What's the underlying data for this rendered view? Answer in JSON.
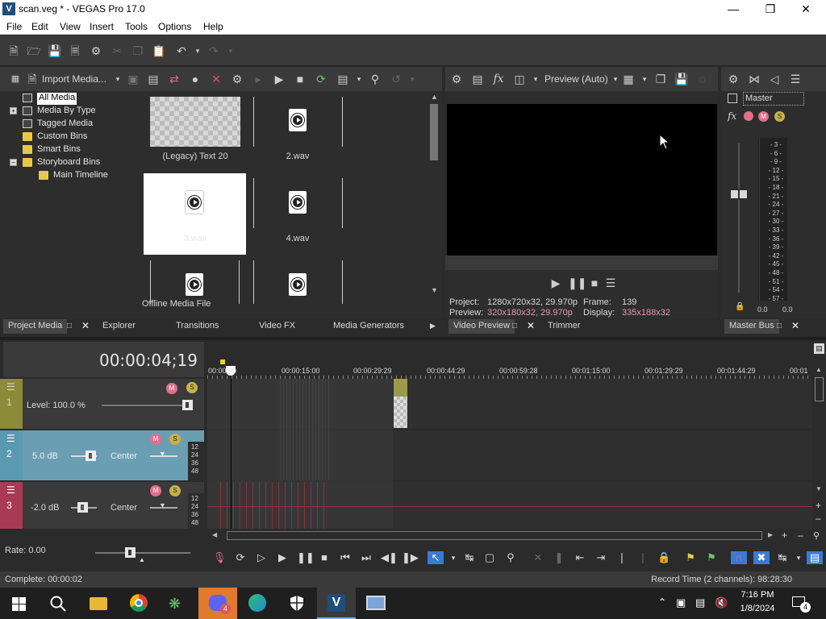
{
  "window": {
    "title": "scan.veg * - VEGAS Pro 17.0",
    "app_icon_letter": "V"
  },
  "menu": [
    "File",
    "Edit",
    "View",
    "Insert",
    "Tools",
    "Options",
    "Help"
  ],
  "project_media": {
    "import_label": "Import Media...",
    "tree": [
      {
        "label": "All Media",
        "selected": true
      },
      {
        "label": "Media By Type"
      },
      {
        "label": "Tagged Media"
      },
      {
        "label": "Custom Bins"
      },
      {
        "label": "Smart Bins"
      },
      {
        "label": "Storyboard Bins"
      },
      {
        "label": "Main Timeline"
      }
    ],
    "items": [
      {
        "label": "(Legacy) Text 20"
      },
      {
        "label": "2.wav"
      },
      {
        "label": "3.wav"
      },
      {
        "label": "4.wav"
      }
    ],
    "status": "Offline Media File"
  },
  "tabs_left": [
    "Project Media",
    "Explorer",
    "Transitions",
    "Video FX",
    "Media Generators"
  ],
  "preview": {
    "mode_label": "Preview (Auto)",
    "project_label": "Project:",
    "project_value": "1280x720x32, 29.970p",
    "frame_label": "Frame:",
    "frame_value": "139",
    "preview_label": "Preview:",
    "preview_value": "320x180x32, 29.970p",
    "display_label": "Display:",
    "display_value": "335x188x32",
    "tab_label": "Video Preview",
    "trimmer_label": "Trimmer"
  },
  "mixer": {
    "master_label": "Master",
    "scale": [
      "3",
      "6",
      "9",
      "12",
      "15",
      "18",
      "21",
      "24",
      "27",
      "30",
      "33",
      "36",
      "39",
      "42",
      "45",
      "48",
      "51",
      "54",
      "57"
    ],
    "left_reading": "0.0",
    "right_reading": "0.0",
    "tab_label": "Master Bus"
  },
  "timeline": {
    "timecode": "00:00:04;19",
    "ruler": [
      "00:00:00",
      "00:00:15:00",
      "00:00:29:29",
      "00:00:44:29",
      "00:00:59:28",
      "00:01:15:00",
      "00:01:29:29",
      "00:01:44:29",
      "00:01"
    ],
    "tracks": [
      {
        "num": "1",
        "label": "Level: 100.0 %",
        "color": "#8b8b3a"
      },
      {
        "num": "2",
        "vol": "5.0 dB",
        "pan": "Center",
        "color": "#5a9ab0"
      },
      {
        "num": "3",
        "vol": "-2.0 dB",
        "pan": "Center",
        "color": "#a83a55"
      }
    ],
    "db_marks": [
      "12",
      "24",
      "36",
      "48"
    ],
    "rate_label": "Rate: 0.00"
  },
  "status": {
    "left": "Complete: 00:00:02",
    "right": "Record Time (2 channels): 98:28:30"
  },
  "taskbar": {
    "time": "7:16 PM",
    "date": "1/8/2024",
    "notification_count": "4",
    "badge_count": "4"
  }
}
